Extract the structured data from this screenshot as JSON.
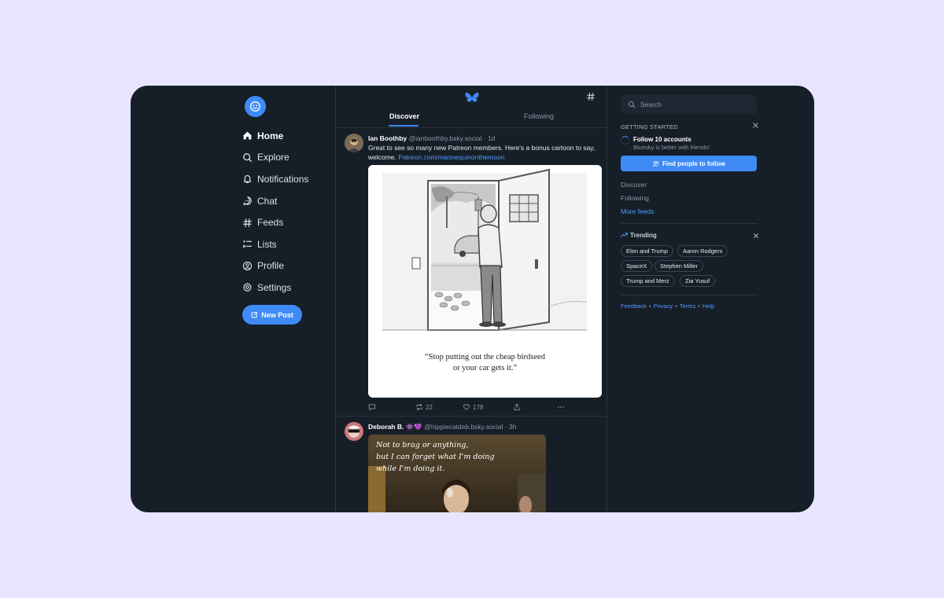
{
  "nav": {
    "items": [
      {
        "label": "Home",
        "icon": "home-icon"
      },
      {
        "label": "Explore",
        "icon": "search-icon"
      },
      {
        "label": "Notifications",
        "icon": "bell-icon"
      },
      {
        "label": "Chat",
        "icon": "chat-icon"
      },
      {
        "label": "Feeds",
        "icon": "hash-icon"
      },
      {
        "label": "Lists",
        "icon": "list-icon"
      },
      {
        "label": "Profile",
        "icon": "profile-icon"
      },
      {
        "label": "Settings",
        "icon": "gear-icon"
      }
    ],
    "new_post_label": "New Post"
  },
  "feed": {
    "tabs": [
      "Discover",
      "Following"
    ],
    "posts": [
      {
        "author": "Ian Boothby",
        "handle": "@ianboothby.bsky.social",
        "time": "1d",
        "text": "Great to see so many new Patreon members. Here's a bonus cartoon to say, welcome.",
        "link": "Patreon.com/mannequinonthemoon",
        "caption_line1": "“Stop putting out the cheap birdseed",
        "caption_line2": "or your car gets it.”",
        "reposts": "22",
        "likes": "178"
      },
      {
        "author": "Deborah B. 👾💜",
        "handle": "@hippiecatdeb.bsky.social",
        "time": "3h",
        "meme_line1": "Not to brag or anything,",
        "meme_line2": "but I can forget what I'm doing",
        "meme_line3": "while I'm doing it."
      }
    ]
  },
  "sidebar": {
    "search_placeholder": "Search",
    "getting_started": {
      "title": "GETTING STARTED",
      "task": "Follow 10 accounts",
      "subtitle": "Bluesky is better with friends!",
      "button": "Find people to follow"
    },
    "links": [
      "Discover",
      "Following",
      "More feeds"
    ],
    "trending": {
      "title": "Trending",
      "topics": [
        "Elon and Trump",
        "Aaron Rodgers",
        "SpaceX",
        "Stephen Miller",
        "Trump and Merz",
        "Zia Yusuf"
      ]
    },
    "footer": [
      "Feedback",
      "Privacy",
      "Terms",
      "Help"
    ]
  },
  "colors": {
    "accent": "#3e8bf5",
    "background": "#161e27",
    "page": "#e8e4ff"
  }
}
